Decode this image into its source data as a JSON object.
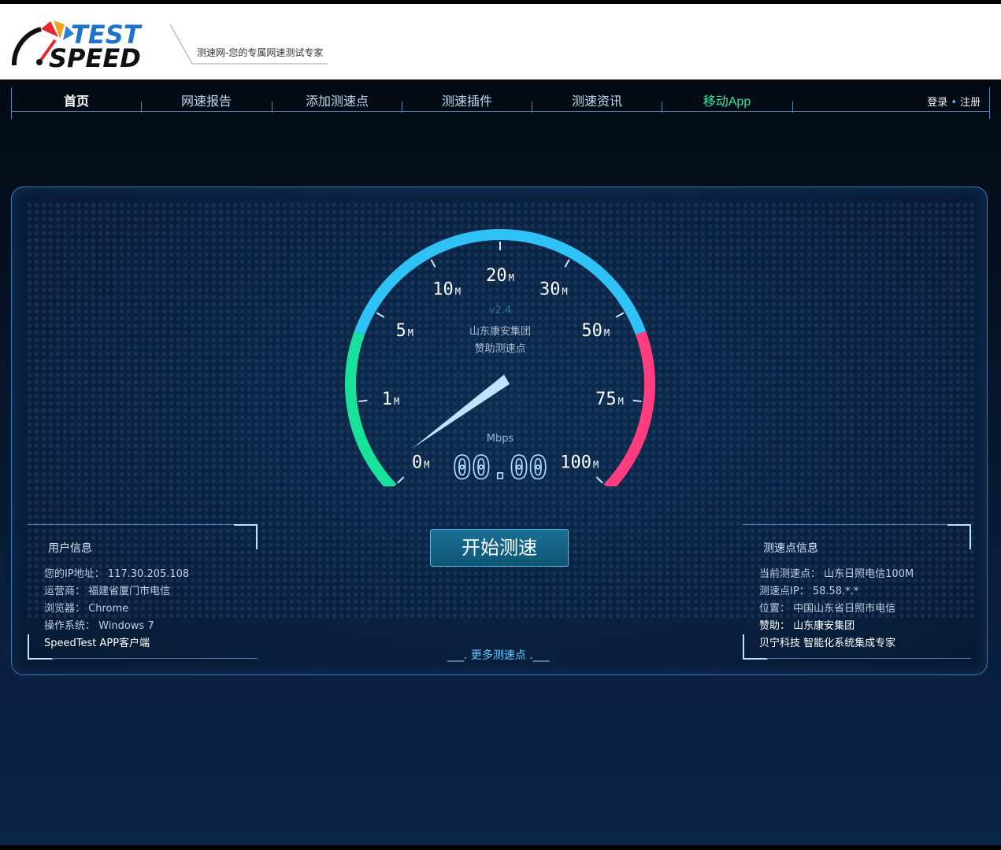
{
  "brand": {
    "logo_line1": "TEST",
    "logo_line2": "SPEED",
    "slogan": "测速网-您的专属网速测试专家"
  },
  "nav": {
    "items": [
      {
        "label": "首页",
        "active": true
      },
      {
        "label": "网速报告"
      },
      {
        "label": "添加测速点"
      },
      {
        "label": "测速插件"
      },
      {
        "label": "测速资讯"
      },
      {
        "label": "移动App",
        "accent": "#2ee6a6"
      }
    ],
    "login": "登录",
    "separator": "•",
    "register": "注册"
  },
  "gauge": {
    "version": "v2.4",
    "sponsor_line1": "山东康安集团",
    "sponsor_line2": "赞助测速点",
    "unit": "Mbps",
    "reading": "00.00",
    "scale": [
      {
        "value": "0",
        "unit": "M"
      },
      {
        "value": "1",
        "unit": "M"
      },
      {
        "value": "5",
        "unit": "M"
      },
      {
        "value": "10",
        "unit": "M"
      },
      {
        "value": "20",
        "unit": "M"
      },
      {
        "value": "30",
        "unit": "M"
      },
      {
        "value": "50",
        "unit": "M"
      },
      {
        "value": "75",
        "unit": "M"
      },
      {
        "value": "100",
        "unit": "M"
      }
    ],
    "colors": {
      "low": "#17e19b",
      "mid": "#2fc2f7",
      "high": "#ff3d7f",
      "needle": "#bfe4ff"
    }
  },
  "start_button": "开始测速",
  "more_nodes": {
    "prefix": "___.",
    "label": " 更多测速点 ",
    "suffix": ".___"
  },
  "user_info": {
    "title": "用户信息",
    "ip_label": "您的IP地址：",
    "ip": "117.30.205.108",
    "isp_label": "运营商：",
    "isp": "福建省厦门市电信",
    "browser_label": "浏览器：",
    "browser": "Chrome",
    "os_label": "操作系统：",
    "os": "Windows 7",
    "app_link": "SpeedTest APP客户端"
  },
  "node_info": {
    "title": "测速点信息",
    "current_label": "当前测速点：",
    "current": "山东日照电信100M",
    "ip_label": "测速点IP：",
    "ip": "58.58.*.*",
    "location_label": "位置：",
    "location": "中国山东省日照市电信",
    "sponsor_label": "赞助：",
    "sponsor": "山东康安集团",
    "ad": "贝宁科技 智能化系统集成专家"
  }
}
